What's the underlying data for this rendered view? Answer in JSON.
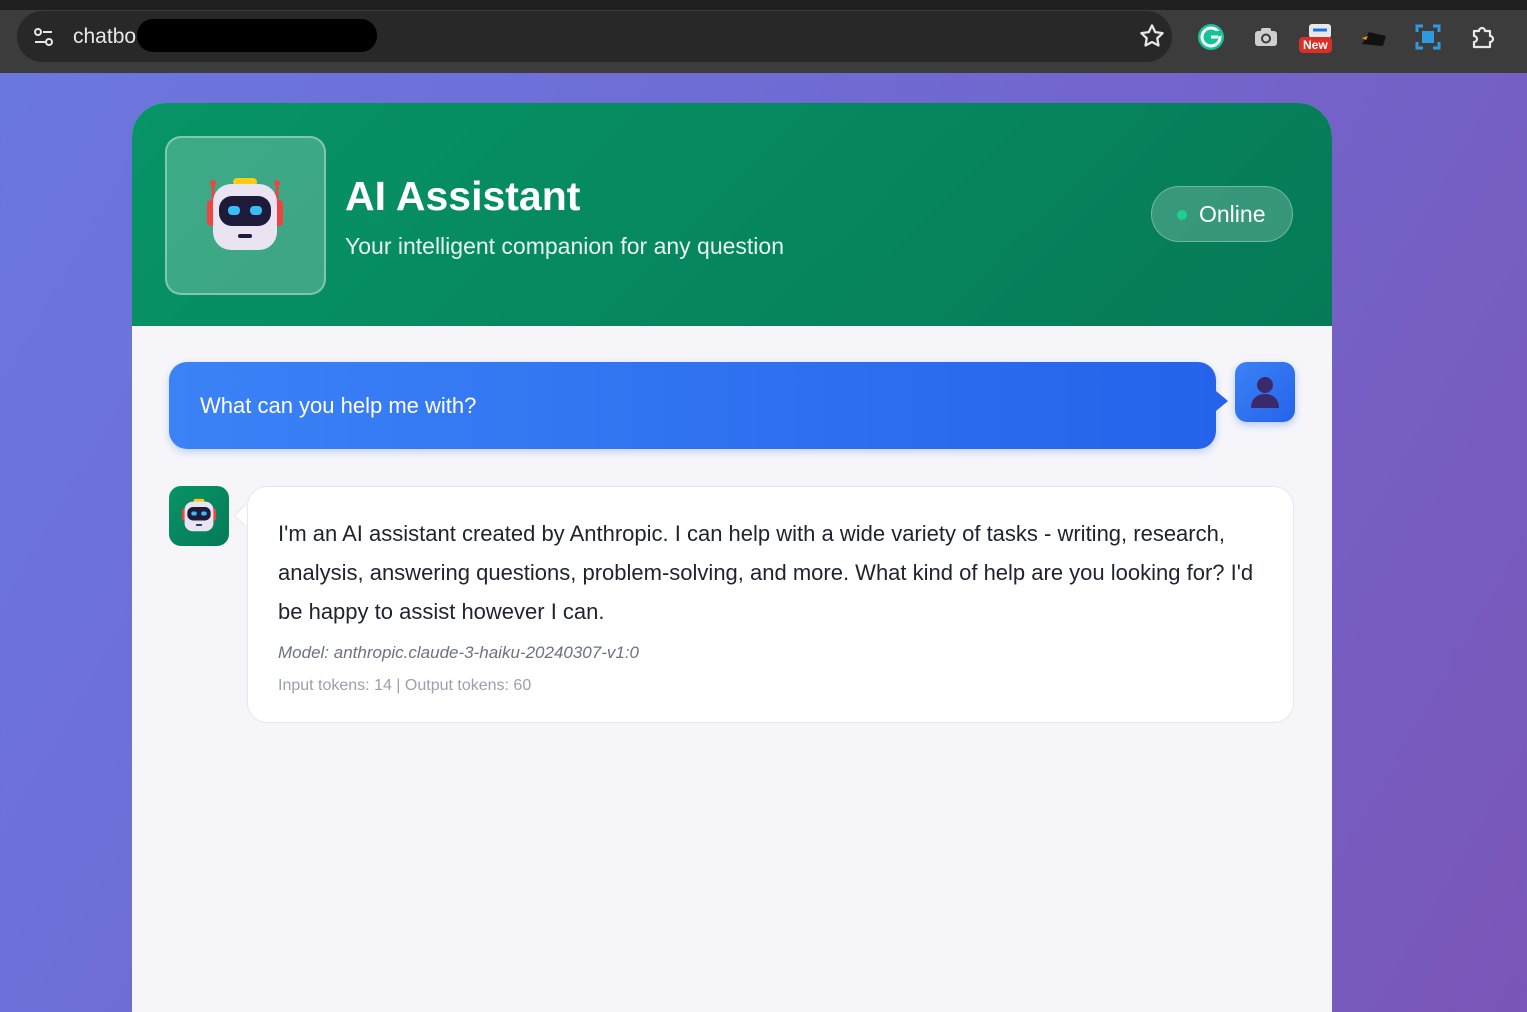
{
  "browser": {
    "url_visible": "chatbo",
    "extension_badge": "New"
  },
  "header": {
    "title": "AI Assistant",
    "subtitle": "Your intelligent companion for any question",
    "status": "Online"
  },
  "messages": [
    {
      "role": "user",
      "text": "What can you help me with?"
    },
    {
      "role": "assistant",
      "text": "I'm an AI assistant created by Anthropic. I can help with a wide variety of tasks - writing, research, analysis, answering questions, problem-solving, and more. What kind of help are you looking for? I'd be happy to assist however I can.",
      "model": "Model: anthropic.claude-3-haiku-20240307-v1:0",
      "tokens": "Input tokens: 14 | Output tokens: 60"
    }
  ],
  "colors": {
    "header_green": "#079466",
    "user_blue": "#2563eb",
    "status_dot": "#1fd08a"
  }
}
